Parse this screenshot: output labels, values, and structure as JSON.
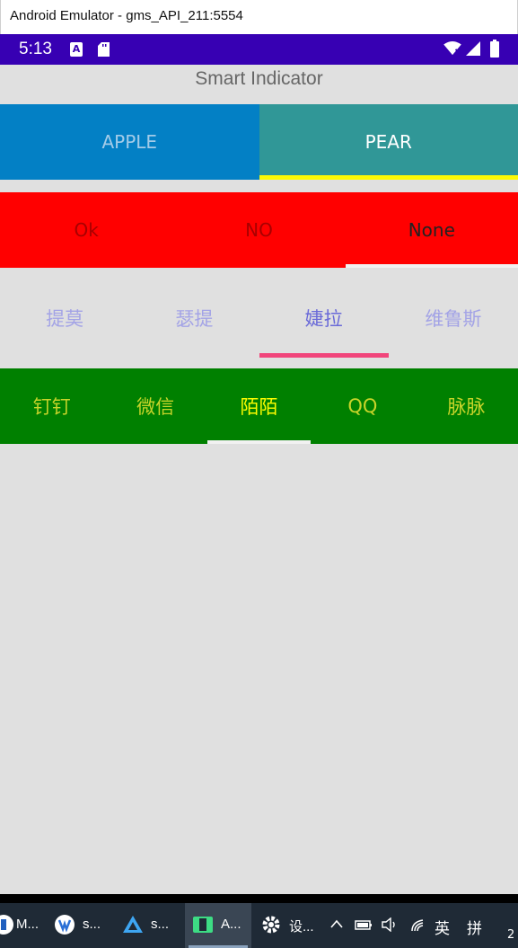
{
  "window": {
    "title": "Android Emulator - gms_API_211:5554"
  },
  "status_bar": {
    "time": "5:13",
    "icons": [
      "a-notification-icon",
      "sd-card-icon",
      "wifi-icon",
      "signal-icon",
      "battery-icon"
    ]
  },
  "app": {
    "title": "Smart Indicator"
  },
  "indicator1": {
    "tabs": [
      "APPLE",
      "PEAR"
    ],
    "selected": 1
  },
  "indicator2": {
    "tabs": [
      "Ok",
      "NO",
      "None"
    ],
    "selected": 2
  },
  "indicator3": {
    "tabs": [
      "提莫",
      "瑟提",
      "婕拉",
      "维鲁斯"
    ],
    "selected": 2
  },
  "indicator4": {
    "tabs": [
      "钉钉",
      "微信",
      "陌陌",
      "QQ",
      "脉脉"
    ],
    "selected": 2
  },
  "colors": {
    "status_bar": "#3700b3",
    "indicator1_tab0": "#0380c5",
    "indicator1_tab1": "#309797",
    "indicator1_line": "#fcf905",
    "indicator2_bg": "#ff0000",
    "indicator3_line": "#f1457b",
    "indicator4_bg": "#008000"
  },
  "taskbar": {
    "items": [
      {
        "label": "M...",
        "icon": "m-app-icon"
      },
      {
        "label": "s...",
        "icon": "s-app-icon"
      },
      {
        "label": "s...",
        "icon": "android-studio-icon"
      },
      {
        "label": "A...",
        "icon": "android-emulator-icon"
      },
      {
        "label": "设...",
        "icon": "settings-gear-icon"
      }
    ],
    "tray": {
      "ime_lang": "英",
      "ime_mode": "拼",
      "clock_fragment": "2"
    }
  }
}
